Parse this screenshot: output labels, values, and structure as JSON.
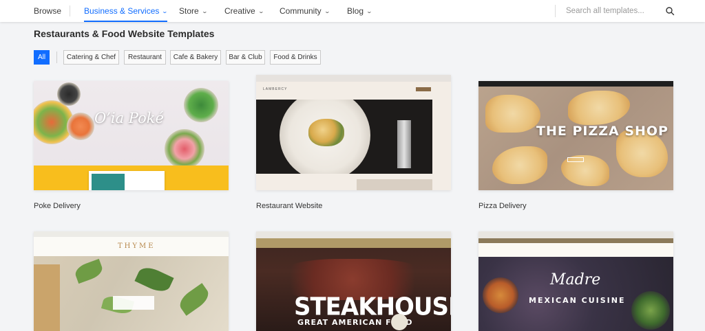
{
  "nav": {
    "browse": "Browse",
    "business": "Business & Services",
    "store": "Store",
    "creative": "Creative",
    "community": "Community",
    "blog": "Blog",
    "search_placeholder": "Search all templates...",
    "active_color": "#116dff"
  },
  "page": {
    "title": "Restaurants & Food Website Templates"
  },
  "filters": {
    "all": "All",
    "catering": "Catering & Chef",
    "restaurant": "Restaurant",
    "cafe": "Cafe & Bakery",
    "bar": "Bar & Club",
    "food": "Food & Drinks",
    "selected": "All"
  },
  "templates": [
    {
      "name": "Poke Delivery",
      "hero_text": "O’ia Poké"
    },
    {
      "name": "Restaurant Website",
      "hero_text": ""
    },
    {
      "name": "Pizza Delivery",
      "hero_text": "THE PIZZA SHOP"
    },
    {
      "name": "",
      "hero_text": "THYME"
    },
    {
      "name": "",
      "hero_text": "STEAKHOUSE",
      "hero_sub": "GREAT AMERICAN FOOD"
    },
    {
      "name": "",
      "hero_text": "Madre",
      "hero_sub": "MEXICAN CUISINE"
    }
  ]
}
